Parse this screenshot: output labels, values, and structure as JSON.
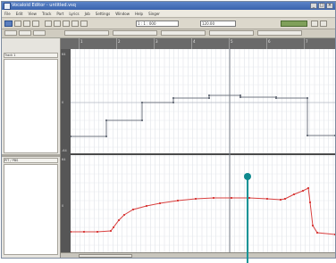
{
  "window": {
    "title": "Vocaloid Editor - untitled.vsq",
    "buttons": [
      "_",
      "□",
      "×"
    ]
  },
  "menu": [
    "File",
    "Edit",
    "View",
    "Track",
    "Part",
    "Lyrics",
    "Job",
    "Settings",
    "Window",
    "Help",
    "Singer"
  ],
  "toolbar": {
    "field1": "1 : 1 : 000",
    "field2": "120.00"
  },
  "left_panel": {
    "top_header": "Track 1",
    "bottom_header": "PIT / PBS"
  },
  "ruler": {
    "labels": [
      "1",
      "2",
      "3",
      "4",
      "5",
      "6",
      "7"
    ]
  },
  "vscale": {
    "top": [
      "64",
      "0",
      "-64"
    ],
    "bottom": [
      "64",
      "0"
    ]
  },
  "colors": {
    "step_line": "#6f7580",
    "curve": "#d9403f",
    "callout": "#159597"
  },
  "chart_data": {
    "type": "line",
    "series": [
      {
        "values": [
          [
            0,
            98
          ],
          [
            40,
            98
          ],
          [
            40,
            80
          ],
          [
            80,
            80
          ],
          [
            80,
            60
          ],
          [
            115,
            60
          ],
          [
            115,
            55
          ],
          [
            155,
            55
          ],
          [
            155,
            52
          ],
          [
            190,
            52
          ],
          [
            190,
            54
          ],
          [
            230,
            54
          ],
          [
            230,
            55
          ],
          [
            265,
            55
          ],
          [
            265,
            97
          ],
          [
            296,
            97
          ]
        ]
      },
      {
        "values": [
          [
            0,
            205
          ],
          [
            15,
            205
          ],
          [
            30,
            205
          ],
          [
            45,
            204
          ],
          [
            48,
            200
          ],
          [
            54,
            192
          ],
          [
            60,
            186
          ],
          [
            70,
            180
          ],
          [
            85,
            176
          ],
          [
            100,
            173
          ],
          [
            120,
            170
          ],
          [
            140,
            168
          ],
          [
            160,
            167
          ],
          [
            180,
            167
          ],
          [
            200,
            167
          ],
          [
            220,
            168
          ],
          [
            235,
            169
          ],
          [
            240,
            168
          ],
          [
            250,
            163
          ],
          [
            260,
            159
          ],
          [
            266,
            156
          ],
          [
            268,
            172
          ],
          [
            271,
            198
          ],
          [
            276,
            206
          ],
          [
            296,
            208
          ]
        ]
      }
    ]
  }
}
